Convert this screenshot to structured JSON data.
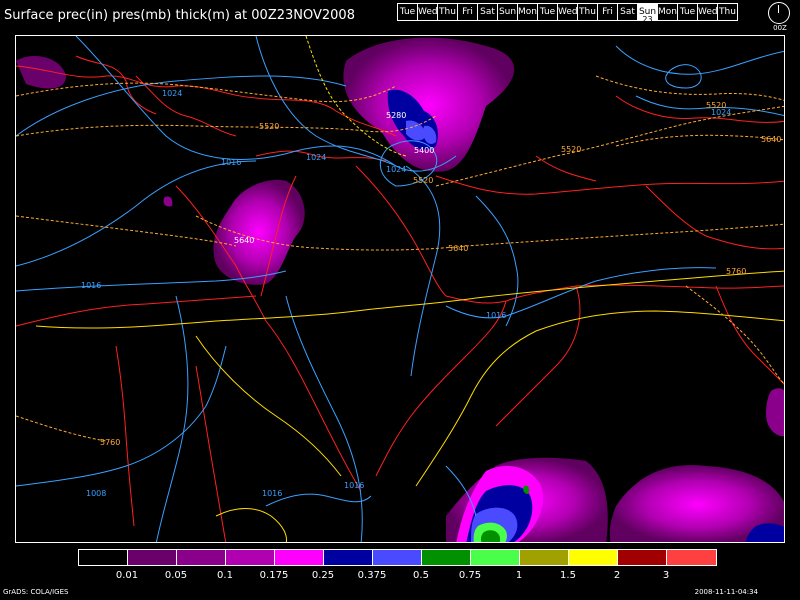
{
  "title": "Surface prec(in) pres(mb) thick(m) at 00Z23NOV2008",
  "days": [
    {
      "label": "Tue"
    },
    {
      "label": "Wed"
    },
    {
      "label": "Thu"
    },
    {
      "label": "Fri"
    },
    {
      "label": "Sat"
    },
    {
      "label": "Sun"
    },
    {
      "label": "Mon"
    },
    {
      "label": "Tue"
    },
    {
      "label": "Wed"
    },
    {
      "label": "Thu"
    },
    {
      "label": "Fri"
    },
    {
      "label": "Sat"
    },
    {
      "label": "Sun",
      "active": true,
      "sub": "23"
    },
    {
      "label": "Mon"
    },
    {
      "label": "Tue"
    },
    {
      "label": "Wed"
    },
    {
      "label": "Thu"
    }
  ],
  "clock_label": "00Z",
  "map": {
    "isobar_labels": [
      "1024",
      "1024",
      "1016",
      "1024",
      "1016",
      "1016",
      "1016",
      "1008",
      "1016",
      "1024"
    ],
    "thickness_labels": [
      "5520",
      "5280",
      "5400",
      "5520",
      "5640",
      "5640",
      "5760",
      "5760",
      "5520",
      "5520",
      "5640"
    ]
  },
  "colorbar": {
    "colors": [
      "#000000",
      "#6a006a",
      "#8a008a",
      "#b000b0",
      "#ff00ff",
      "#0000a0",
      "#4a4aff",
      "#009000",
      "#4aff4a",
      "#a0a000",
      "#ffff00",
      "#a00000",
      "#ff4040"
    ],
    "labels": [
      "0.01",
      "0.05",
      "0.1",
      "0.175",
      "0.25",
      "0.375",
      "0.5",
      "0.75",
      "1",
      "1.5",
      "2",
      "3"
    ]
  },
  "footer": {
    "left": "GrADS: COLA/IGES",
    "right": "2008-11-11-04:34"
  }
}
